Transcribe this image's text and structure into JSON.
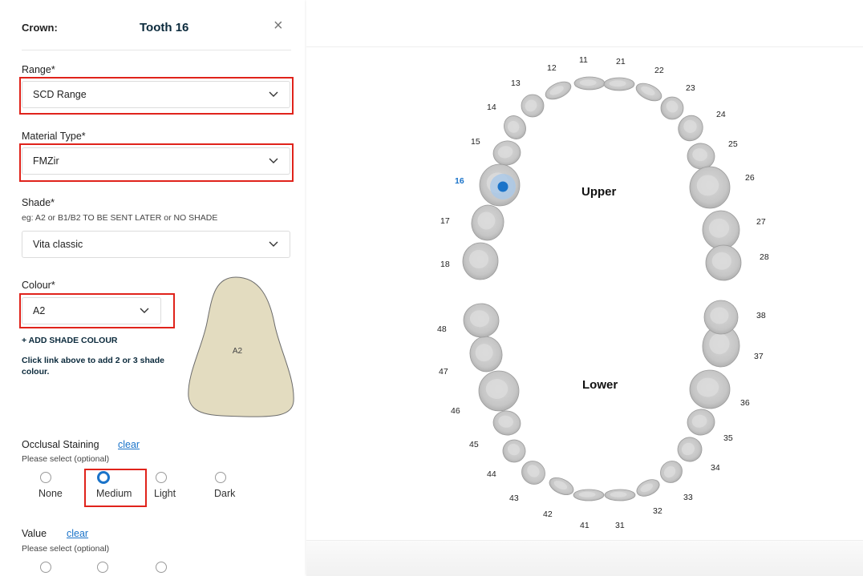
{
  "header": {
    "label": "Crown:",
    "title": "Tooth 16",
    "close_icon": "close-icon"
  },
  "range": {
    "label": "Range*",
    "value": "SCD Range"
  },
  "material": {
    "label": "Material Type*",
    "value": "FMZir"
  },
  "shade": {
    "label": "Shade*",
    "hint": "eg: A2 or B1/B2 TO BE SENT LATER or NO SHADE",
    "value": "Vita classic"
  },
  "colour": {
    "label": "Colour*",
    "value": "A2",
    "add_link": "+ ADD SHADE COLOUR",
    "add_hint": "Click link above to add 2 or 3 shade colour.",
    "preview_label": "A2",
    "preview_color": "#e3dcc0"
  },
  "staining": {
    "label": "Occlusal Staining",
    "clear": "clear",
    "hint": "Please select (optional)",
    "options": [
      "None",
      "Medium",
      "Light",
      "Dark"
    ],
    "selected": "Medium"
  },
  "value_section": {
    "label": "Value",
    "clear": "clear",
    "hint": "Please select (optional)"
  },
  "chart": {
    "upper_label": "Upper",
    "lower_label": "Lower",
    "selected_tooth": "16",
    "accent_color": "#1a73c9",
    "highlight_color": "#e0231b",
    "teeth": {
      "t11": "11",
      "t12": "12",
      "t13": "13",
      "t14": "14",
      "t15": "15",
      "t16": "16",
      "t17": "17",
      "t18": "18",
      "t21": "21",
      "t22": "22",
      "t23": "23",
      "t24": "24",
      "t25": "25",
      "t26": "26",
      "t27": "27",
      "t28": "28",
      "t31": "31",
      "t32": "32",
      "t33": "33",
      "t34": "34",
      "t35": "35",
      "t36": "36",
      "t37": "37",
      "t38": "38",
      "t41": "41",
      "t42": "42",
      "t43": "43",
      "t44": "44",
      "t45": "45",
      "t46": "46",
      "t47": "47",
      "t48": "48"
    }
  }
}
